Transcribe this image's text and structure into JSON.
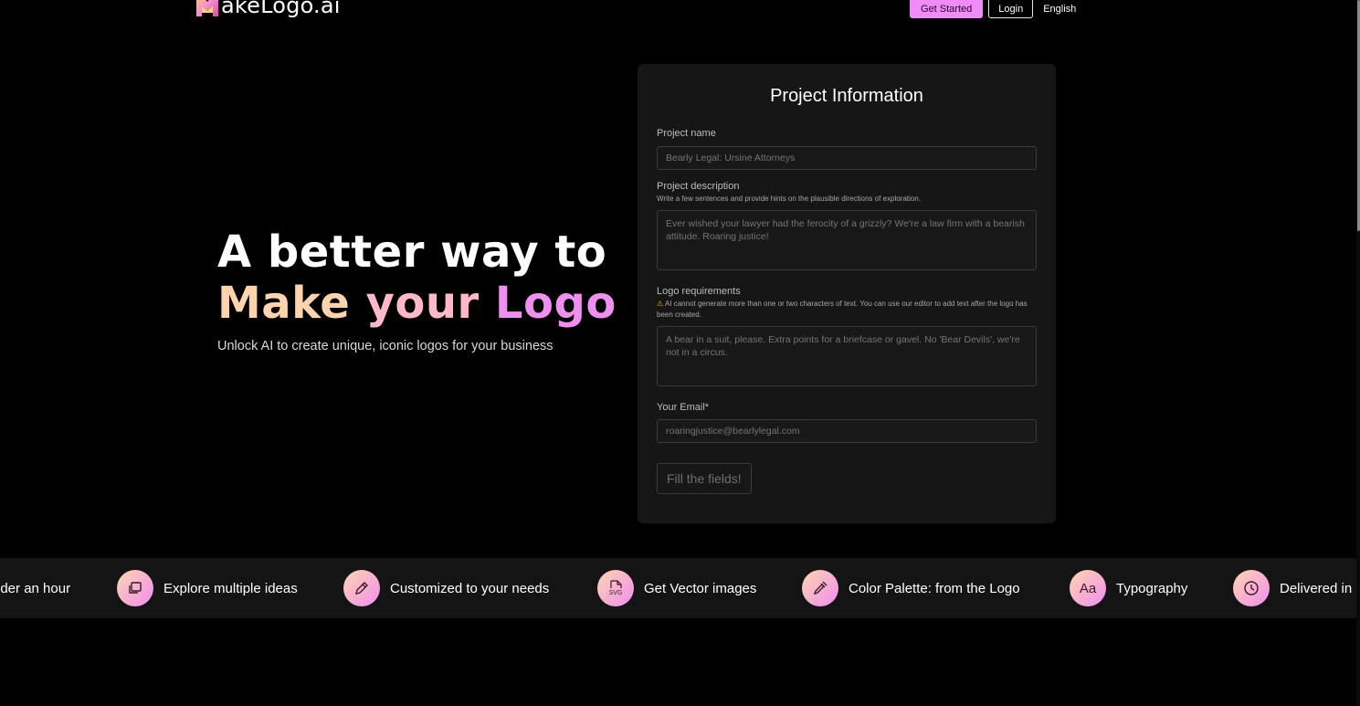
{
  "brand": {
    "name": "akeLogo.ai",
    "mark": "M",
    "colors": {
      "pink": "#f08cf6",
      "peach": "#ffd3ad",
      "rose": "#ffb8c7"
    }
  },
  "nav": {
    "get_started": "Get Started",
    "login": "Login",
    "language": "English"
  },
  "hero": {
    "line1": "A better way to",
    "line2_w1": "Make",
    "line2_w2": "your",
    "line2_w3": "Logo",
    "subtitle": "Unlock AI to create unique, iconic logos for your business"
  },
  "form": {
    "title": "Project Information",
    "project_name": {
      "label": "Project name",
      "placeholder": "Bearly Legal: Ursine Attorneys"
    },
    "project_description": {
      "label": "Project description",
      "hint": "Write a few sentences and provide hints on the plausible directions of exploration.",
      "placeholder": "Ever wished your lawyer had the ferocity of a grizzly? We're a law firm with a bearish attitude. Roaring justice!"
    },
    "logo_requirements": {
      "label": "Logo requirements",
      "warning_icon": "⚠",
      "hint": "AI cannot generate more than one or two characters of text. You can use our editor to add text after the logo has been created.",
      "placeholder": "A bear in a suit, please. Extra points for a briefcase or gavel. No 'Bear Devils', we're not in a circus."
    },
    "email": {
      "label": "Your Email*",
      "placeholder": "roaringjustice@bearlylegal.com"
    },
    "submit": "Fill the fields!"
  },
  "features": [
    {
      "icon": "",
      "text": "nder an hour"
    },
    {
      "icon": "layers-icon",
      "text": "Explore multiple ideas"
    },
    {
      "icon": "pencil-icon",
      "text": "Customized to your needs"
    },
    {
      "icon": "svg-file-icon",
      "text": "Get Vector images",
      "icon_text": "SVG"
    },
    {
      "icon": "eyedropper-icon",
      "text": "Color Palette: from the Logo"
    },
    {
      "icon": "typography-icon",
      "text": "Typography",
      "icon_text": "Aa"
    },
    {
      "icon": "clock-icon",
      "text": "Delivered in"
    }
  ]
}
